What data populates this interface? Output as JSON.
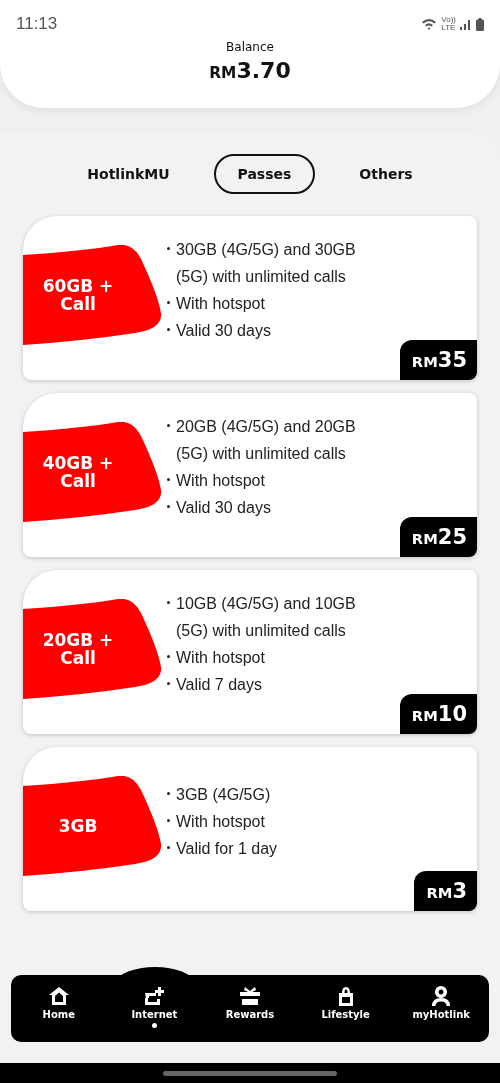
{
  "status_bar": {
    "time": "11:13",
    "volte_top": "Vo))",
    "volte_bottom": "LTE"
  },
  "balance": {
    "label": "Balance",
    "currency": "RM",
    "amount": "3.70"
  },
  "tabs": [
    {
      "label": "HotlinkMU",
      "selected": false
    },
    {
      "label": "Passes",
      "selected": true
    },
    {
      "label": "Others",
      "selected": false
    }
  ],
  "passes": [
    {
      "title_line1": "60GB +",
      "title_line2": "Call",
      "features": [
        "30GB (4G/5G) and 30GB (5G) with unlimited calls",
        "With hotspot",
        "Valid 30 days"
      ],
      "price": {
        "currency": "RM",
        "amount": "35"
      }
    },
    {
      "title_line1": "40GB +",
      "title_line2": "Call",
      "features": [
        "20GB (4G/5G) and 20GB (5G) with unlimited calls",
        "With hotspot",
        "Valid 30 days"
      ],
      "price": {
        "currency": "RM",
        "amount": "25"
      }
    },
    {
      "title_line1": "20GB +",
      "title_line2": "Call",
      "features": [
        "10GB (4G/5G) and 10GB (5G) with unlimited calls",
        "With hotspot",
        "Valid 7 days"
      ],
      "price": {
        "currency": "RM",
        "amount": "10"
      }
    },
    {
      "title_line1": "3GB",
      "features": [
        "3GB (4G/5G)",
        "With hotspot",
        "Valid for 1 day"
      ],
      "price": {
        "currency": "RM",
        "amount": "3"
      }
    }
  ],
  "nav": [
    {
      "kind": "home",
      "label": "Home",
      "selected": false
    },
    {
      "kind": "internet",
      "label": "Internet",
      "selected": true
    },
    {
      "kind": "rewards",
      "label": "Rewards",
      "selected": false
    },
    {
      "kind": "lifestyle",
      "label": "Lifestyle",
      "selected": false
    },
    {
      "kind": "account",
      "label": "myHotlink",
      "selected": false
    }
  ]
}
